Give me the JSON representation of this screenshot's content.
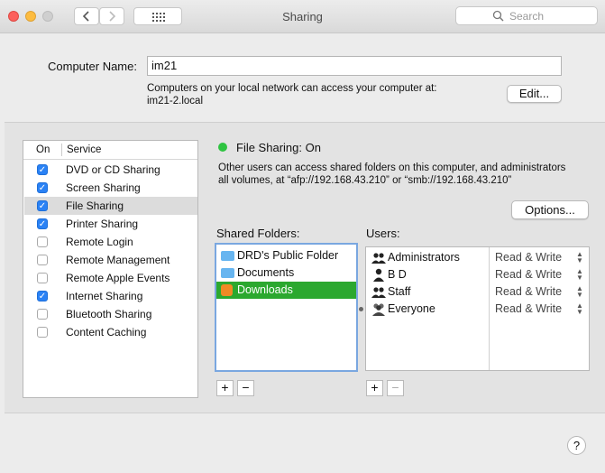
{
  "window": {
    "title": "Sharing"
  },
  "toolbar": {
    "search_placeholder": "Search"
  },
  "computer": {
    "name_label": "Computer Name:",
    "name_value": "im21",
    "info_line1": "Computers on your local network can access your computer at:",
    "info_line2": "im21-2.local",
    "edit_label": "Edit..."
  },
  "services": {
    "col_on": "On",
    "col_service": "Service",
    "items": [
      {
        "label": "DVD or CD Sharing",
        "checked": true
      },
      {
        "label": "Screen Sharing",
        "checked": true
      },
      {
        "label": "File Sharing",
        "checked": true,
        "selected": true
      },
      {
        "label": "Printer Sharing",
        "checked": true
      },
      {
        "label": "Remote Login",
        "checked": false
      },
      {
        "label": "Remote Management",
        "checked": false
      },
      {
        "label": "Remote Apple Events",
        "checked": false
      },
      {
        "label": "Internet Sharing",
        "checked": true
      },
      {
        "label": "Bluetooth Sharing",
        "checked": false
      },
      {
        "label": "Content Caching",
        "checked": false
      }
    ]
  },
  "status": {
    "title": "File Sharing: On",
    "color": "#2fc441",
    "desc_line1": "Other users can access shared folders on this computer, and administrators",
    "desc_line2": "all volumes, at “afp://192.168.43.210” or “smb://192.168.43.210”",
    "options_label": "Options..."
  },
  "shared_folders": {
    "label": "Shared Folders:",
    "items": [
      "DRD's Public Folder",
      "Documents",
      "Downloads"
    ],
    "selected_color": "#2ba82f"
  },
  "users": {
    "label": "Users:",
    "items": [
      {
        "name": "Administrators",
        "perm": "Read & Write",
        "icon": "group-icon"
      },
      {
        "name": "B D",
        "perm": "Read & Write",
        "icon": "user-icon"
      },
      {
        "name": "Staff",
        "perm": "Read & Write",
        "icon": "group-icon"
      },
      {
        "name": "Everyone",
        "perm": "Read & Write",
        "icon": "everyone-icon"
      }
    ]
  },
  "controls": {
    "plus": "+",
    "minus": "−",
    "help": "?"
  }
}
